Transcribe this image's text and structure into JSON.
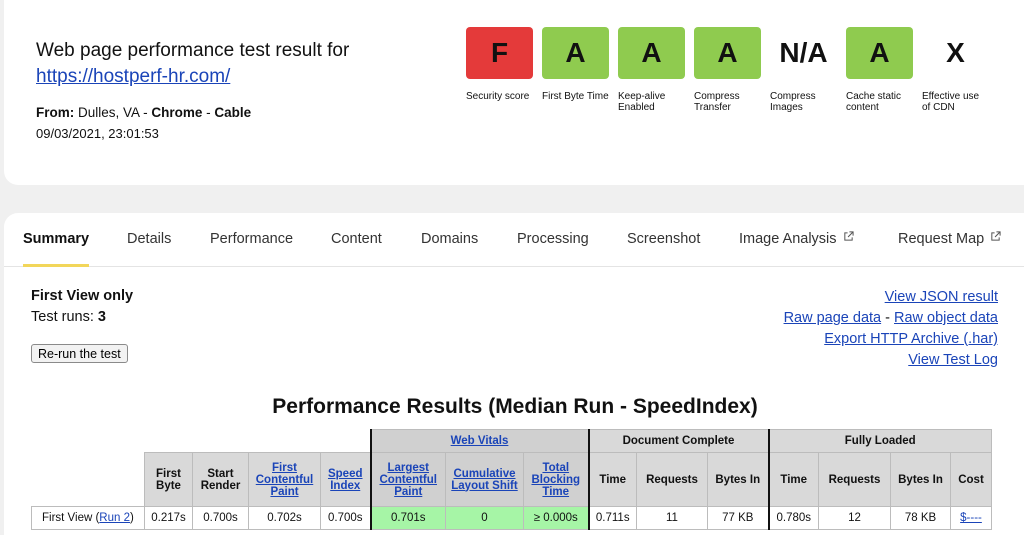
{
  "header": {
    "title": "Web page performance test result for",
    "url": "https://hostperf-hr.com/",
    "from_label": "From:",
    "location": "Dulles, VA",
    "sep1": "-",
    "browser": "Chrome",
    "sep2": "-",
    "connection": "Cable",
    "date": "09/03/2021, 23:01:53"
  },
  "grades": [
    {
      "grade": "F",
      "label": "Security score",
      "color": "#e43a3a"
    },
    {
      "grade": "A",
      "label": "First Byte Time",
      "color": "#8fcb4f"
    },
    {
      "grade": "A",
      "label": "Keep-alive Enabled",
      "color": "#8fcb4f"
    },
    {
      "grade": "A",
      "label": "Compress Transfer",
      "color": "#8fcb4f"
    },
    {
      "grade": "N/A",
      "label": "Compress Images",
      "color": ""
    },
    {
      "grade": "A",
      "label": "Cache static content",
      "color": "#8fcb4f"
    },
    {
      "grade": "X",
      "label": "Effective use of CDN",
      "color": ""
    }
  ],
  "tabs": [
    {
      "label": "Summary"
    },
    {
      "label": "Details"
    },
    {
      "label": "Performance"
    },
    {
      "label": "Content"
    },
    {
      "label": "Domains"
    },
    {
      "label": "Processing"
    },
    {
      "label": "Screenshot"
    },
    {
      "label": "Image Analysis"
    },
    {
      "label": "Request Map"
    }
  ],
  "summary": {
    "view_title": "First View only",
    "test_runs_label": "Test runs:",
    "test_runs_value": "3",
    "rerun_button": "Re-run the test"
  },
  "links": {
    "json": "View JSON result",
    "raw_page": "Raw page data",
    "dash": "-",
    "raw_object": "Raw object data",
    "har": "Export HTTP Archive (.har)",
    "log": "View Test Log"
  },
  "results": {
    "title": "Performance Results (Median Run - SpeedIndex)",
    "groups": {
      "web_vitals": "Web Vitals",
      "document_complete": "Document Complete",
      "fully_loaded": "Fully Loaded"
    },
    "columns": {
      "first_byte": "First Byte",
      "start_render": "Start Render",
      "first_contentful_paint": "First Contentful Paint",
      "speed_index": "Speed Index",
      "lcp": "Largest Contentful Paint",
      "cls": "Cumulative Layout Shift",
      "tbt": "Total Blocking Time",
      "dc_time": "Time",
      "dc_requests": "Requests",
      "dc_bytes": "Bytes In",
      "fl_time": "Time",
      "fl_requests": "Requests",
      "fl_bytes": "Bytes In",
      "cost": "Cost"
    },
    "row": {
      "label": "First View (",
      "run_link": "Run 2",
      "label_end": ")",
      "first_byte": "0.217s",
      "start_render": "0.700s",
      "fcp": "0.702s",
      "speed_index": "0.700s",
      "lcp": "0.701s",
      "cls": "0",
      "tbt": "≥ 0.000s",
      "dc_time": "0.711s",
      "dc_requests": "11",
      "dc_bytes": "77 KB",
      "fl_time": "0.780s",
      "fl_requests": "12",
      "fl_bytes": "78 KB",
      "cost": "$----"
    }
  }
}
